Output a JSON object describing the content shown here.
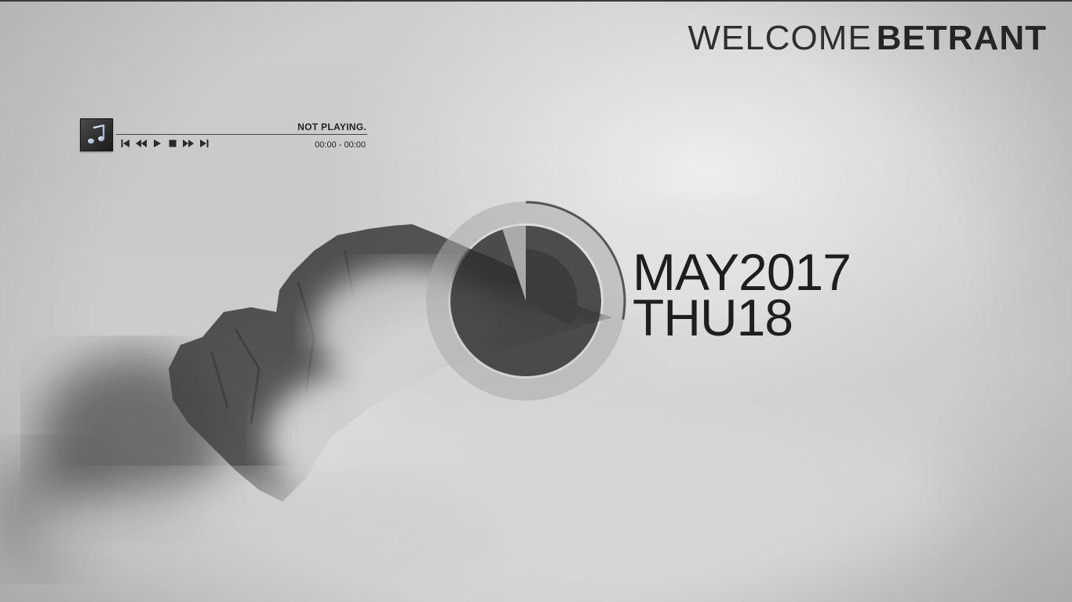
{
  "welcome": {
    "greeting": "WELCOME",
    "user_name": "BETRANT"
  },
  "player": {
    "album_icon": "music-note-icon",
    "status": "NOT PLAYING.",
    "time": "00:00 - 00:00",
    "controls": [
      {
        "name": "previous-track",
        "icon": "skip-previous-icon"
      },
      {
        "name": "rewind",
        "icon": "rewind-icon"
      },
      {
        "name": "play",
        "icon": "play-icon"
      },
      {
        "name": "stop",
        "icon": "stop-icon"
      },
      {
        "name": "fast-forward",
        "icon": "fast-forward-icon"
      },
      {
        "name": "next-track",
        "icon": "skip-next-icon"
      }
    ]
  },
  "clock": {
    "hour_fraction": 0.33,
    "minute_fraction": 0.95,
    "second_fraction": 0.28,
    "colors": {
      "outer_ring": "#a9a9a9",
      "face": "#2c2c2c",
      "sector": "#3c3c3c",
      "accent": "#555555"
    }
  },
  "date": {
    "month": "MAY",
    "year": "2017",
    "weekday": "THU",
    "day": "18"
  }
}
